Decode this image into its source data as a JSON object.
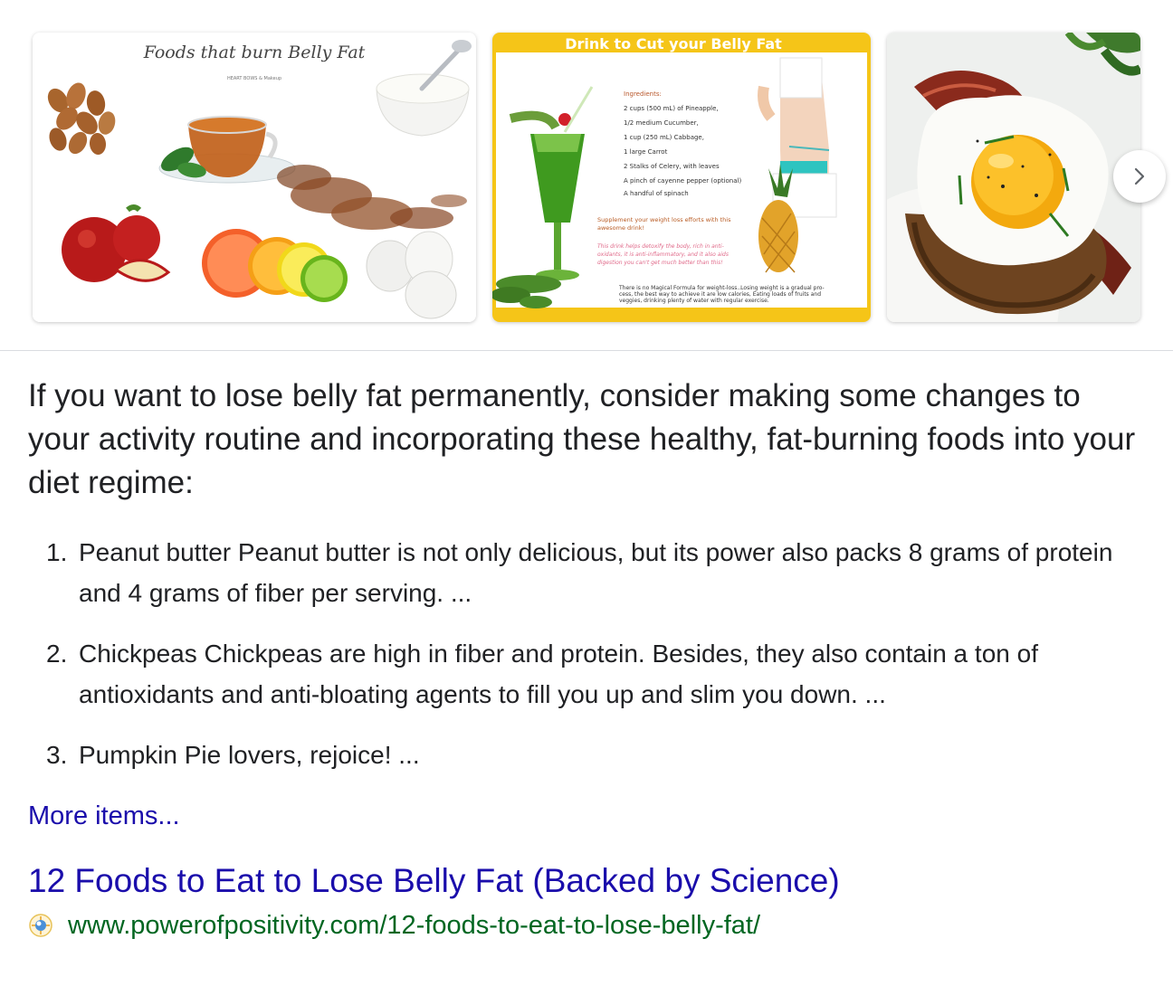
{
  "carousel": {
    "images": [
      {
        "caption": "Foods that burn Belly Fat",
        "credit": "HEART BOWS & Makeup"
      },
      {
        "banner": "Drink to Cut your Belly Fat",
        "ingredients_title": "Ingredients:",
        "ingredients": [
          "2 cups (500 mL) of Pineapple,",
          "1/2 medium Cucumber,",
          "1 cup (250 mL) Cabbage,",
          "1 large Carrot",
          "2 Stalks of Celery, with leaves",
          "A pinch of cayenne pepper (optional)",
          "A handful of spinach"
        ],
        "supplement_line1": "Supplement your weight loss efforts with this",
        "supplement_line2": "awesome drink!",
        "note_line1": "This drink helps detoxify the body, rich in anti-",
        "note_line2": "oxidants, it is anti-inflammatory, and it also aids",
        "note_line3": "digestion you can't get much better than this!",
        "footer_line1": "There is no Magical Formula for weight-loss..Losing weight is a gradual pro-",
        "footer_line2": "cess, the best way to achieve it are low calories, Eating loads of fruits and",
        "footer_line3": "veggies, drinking plenty of water with regular exercise."
      },
      {
        "alt": "fried egg on toast with bacon"
      }
    ],
    "next_icon": "chevron-right-icon"
  },
  "snippet": {
    "intro": "If you want to lose belly fat permanently, consider making some changes to your activity routine and incorporating these healthy, fat-burning foods into your diet regime:",
    "items": [
      {
        "number": "1.",
        "text": "Peanut butter Peanut butter is not only delicious, but its power also packs 8 grams of protein and 4 grams of fiber per serving. ..."
      },
      {
        "number": "2.",
        "text": "Chickpeas Chickpeas are high in fiber and protein. Besides, they also contain a ton of antioxidants and anti-bloating agents to fill you up and slim you down. ..."
      },
      {
        "number": "3.",
        "text": "Pumpkin Pie lovers, rejoice! ..."
      }
    ],
    "more_items": "More items..."
  },
  "result": {
    "title": "12 Foods to Eat to Lose Belly Fat (Backed by Science)",
    "url": "www.powerofpositivity.com/12-foods-to-eat-to-lose-belly-fat/",
    "favicon_icon": "site-favicon-icon"
  },
  "colors": {
    "link": "#1a0dab",
    "url": "#006621",
    "text": "#202124",
    "divider": "#dadce0",
    "drink_banner": "#f5c518"
  }
}
